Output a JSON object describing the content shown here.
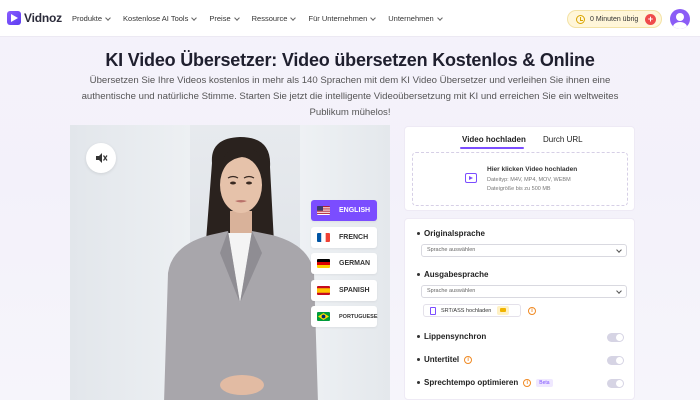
{
  "nav": {
    "logo_text": "Vidnoz",
    "menu": [
      {
        "label": "Produkte"
      },
      {
        "label": "Kostenlose AI Tools"
      },
      {
        "label": "Preise"
      },
      {
        "label": "Ressource"
      },
      {
        "label": "Für Unternehmen"
      },
      {
        "label": "Unternehmen"
      }
    ],
    "minutes_label": "0 Minuten übrig",
    "plus": "+"
  },
  "hero": {
    "title": "KI Video Übersetzer: Video übersetzen Kostenlos & Online",
    "subtitle": "Übersetzen Sie Ihre Videos kostenlos in mehr als 140 Sprachen mit dem KI Video Übersetzer und verleihen Sie ihnen eine authentische und natürliche Stimme. Starten Sie jetzt die intelligente Videoübersetzung mit KI und erreichen Sie ein weltweites Publikum mühelos!"
  },
  "video": {
    "languages": [
      {
        "label": "ENGLISH",
        "active": true
      },
      {
        "label": "FRENCH",
        "active": false
      },
      {
        "label": "GERMAN",
        "active": false
      },
      {
        "label": "SPANISH",
        "active": false
      },
      {
        "label": "PORTUGUESE",
        "active": false
      }
    ]
  },
  "upload": {
    "tab_upload": "Video hochladen",
    "tab_url": "Durch URL",
    "dz_title": "Hier klicken Video hochladen",
    "dz_types": "Dateityp: M4V, MP4, MOV, WEBM",
    "dz_size": "Dateigröße bis zu 500 MB"
  },
  "settings": {
    "original_label": "Originalsprache",
    "original_placeholder": "Sprache auswählen",
    "output_label": "Ausgabesprache",
    "output_placeholder": "Sprache auswählen",
    "srt_label": "SRT/ASS hochladen",
    "lipsync_label": "Lippensynchron",
    "subtitle_label": "Untertitel",
    "speed_label": "Sprechtempo optimieren",
    "beta": "Beta"
  }
}
